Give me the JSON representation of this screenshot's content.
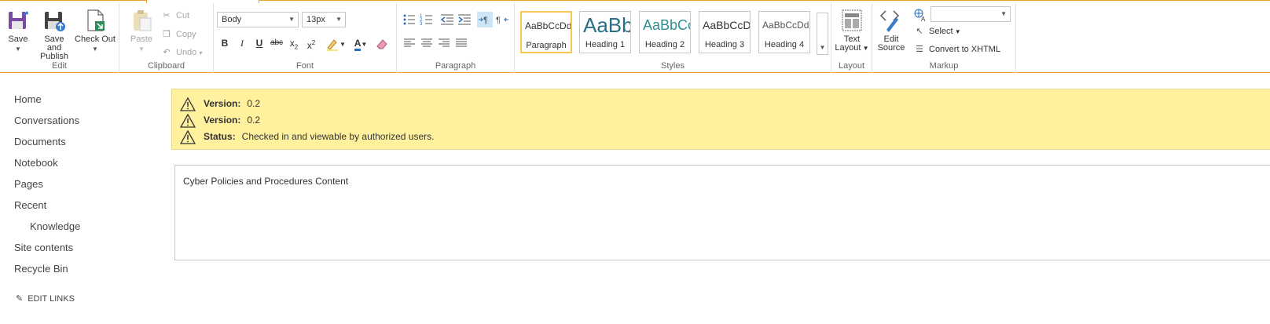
{
  "ribbon": {
    "edit": {
      "group_label": "Edit",
      "save_label": "Save",
      "save_publish_line1": "Save and",
      "save_publish_line2": "Publish",
      "checkout_label": "Check Out"
    },
    "clipboard": {
      "group_label": "Clipboard",
      "paste_label": "Paste",
      "cut_label": "Cut",
      "copy_label": "Copy",
      "undo_label": "Undo"
    },
    "font": {
      "group_label": "Font",
      "font_family": "Body",
      "font_size": "13px",
      "bold": "B",
      "italic": "I",
      "underline": "U",
      "strikethrough": "abc",
      "subscript": "x",
      "superscript": "x",
      "font_color": "A"
    },
    "paragraph": {
      "group_label": "Paragraph"
    },
    "styles": {
      "group_label": "Styles",
      "items": [
        {
          "preview": "AaBbCcDdE",
          "name": "Paragraph"
        },
        {
          "preview": "AaBb",
          "name": "Heading 1"
        },
        {
          "preview": "AaBbCc",
          "name": "Heading 2"
        },
        {
          "preview": "AaBbCcDc",
          "name": "Heading 3"
        },
        {
          "preview": "AaBbCcDdE",
          "name": "Heading 4"
        }
      ]
    },
    "layout": {
      "group_label": "Layout",
      "text_layout_line1": "Text",
      "text_layout_line2": "Layout"
    },
    "markup": {
      "group_label": "Markup",
      "edit_source_line1": "Edit",
      "edit_source_line2": "Source",
      "select_label": "Select",
      "convert_label": "Convert to XHTML",
      "language_value": ""
    }
  },
  "nav": {
    "items": [
      "Home",
      "Conversations",
      "Documents",
      "Notebook",
      "Pages",
      "Recent"
    ],
    "sub_item": "Knowledge",
    "items_after": [
      "Site contents",
      "Recycle Bin"
    ],
    "edit_links": "EDIT LINKS"
  },
  "status": {
    "rows": [
      {
        "label": "Version:",
        "value": "0.2"
      },
      {
        "label": "Version:",
        "value": "0.2"
      },
      {
        "label": "Status:",
        "value": "Checked in and viewable by authorized users."
      }
    ]
  },
  "content": {
    "text": "Cyber Policies and Procedures Content"
  },
  "colors": {
    "accent": "#f0a030",
    "status_bg": "#fff19e",
    "selected_style": "#f8c753"
  }
}
